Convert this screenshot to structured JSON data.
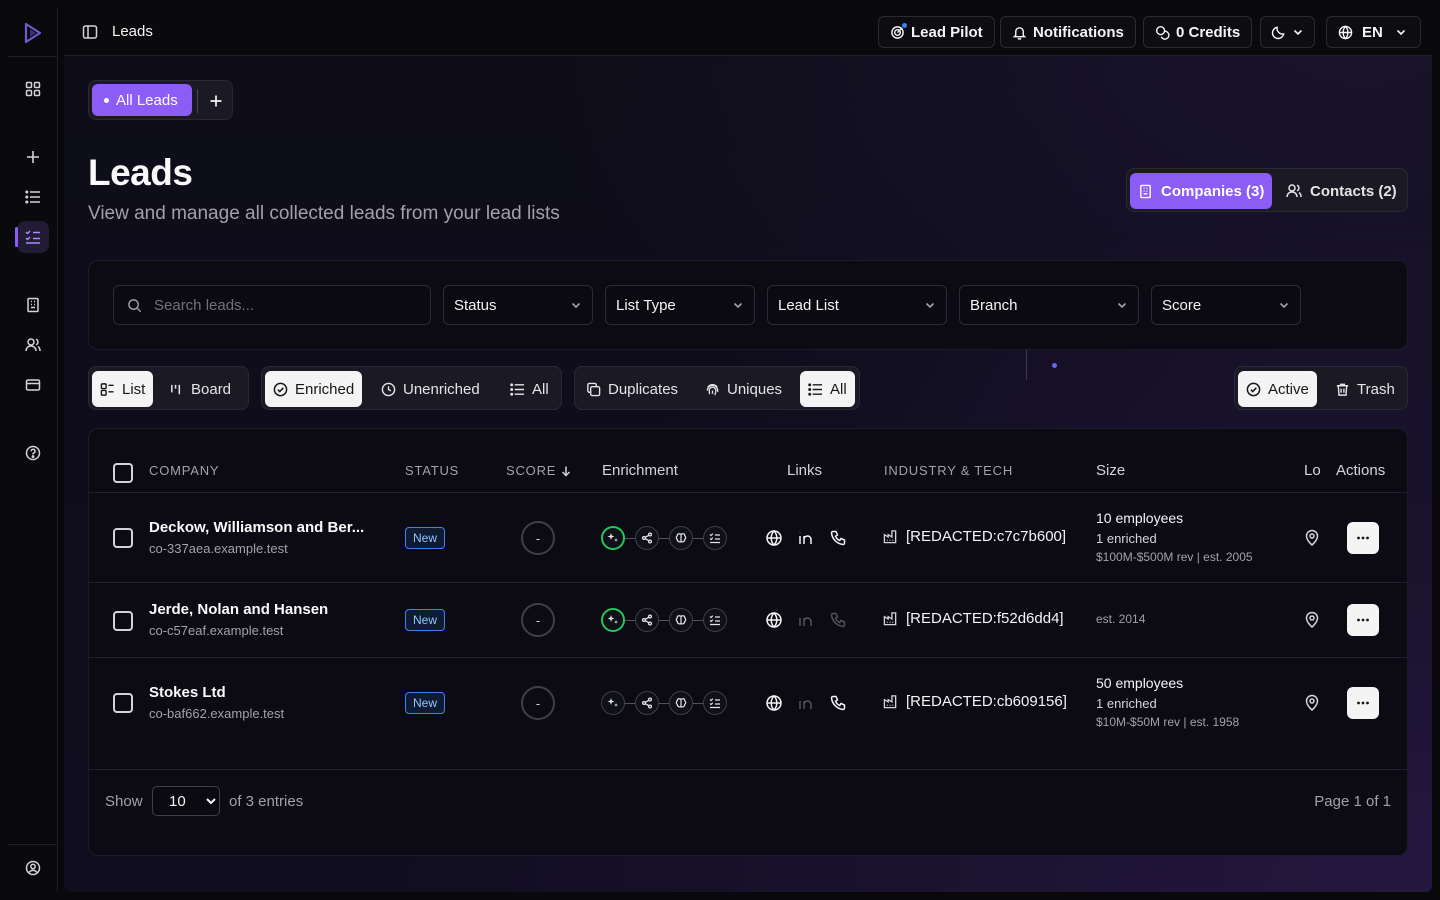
{
  "sidebar": {
    "items": [
      {
        "name": "dashboard",
        "icon": "grid-icon"
      },
      {
        "name": "new",
        "icon": "plus-icon"
      },
      {
        "name": "lists",
        "icon": "list-icon"
      },
      {
        "name": "leads",
        "icon": "list-check-icon",
        "active": true
      },
      {
        "name": "companies",
        "icon": "building-icon"
      },
      {
        "name": "contacts",
        "icon": "users-icon"
      },
      {
        "name": "billing",
        "icon": "credit-card-icon"
      },
      {
        "name": "help",
        "icon": "help-circle-icon"
      },
      {
        "name": "account",
        "icon": "user-circle-icon"
      }
    ]
  },
  "topbar": {
    "title": "Leads",
    "lead_pilot": "Lead Pilot",
    "notifications": "Notifications",
    "credits": "0 Credits",
    "language": "EN"
  },
  "tabs": {
    "all_leads": "All Leads"
  },
  "header": {
    "title": "Leads",
    "subtitle": "View and manage all collected leads from your lead lists",
    "companies": "Companies (3)",
    "contacts": "Contacts (2)"
  },
  "filters": {
    "search_placeholder": "Search leads...",
    "status": "Status",
    "list_type": "List Type",
    "lead_list": "Lead List",
    "branch": "Branch",
    "score": "Score"
  },
  "view_modes": {
    "list": "List",
    "board": "Board"
  },
  "enrichment_filter": {
    "enriched": "Enriched",
    "unenriched": "Unenriched",
    "all": "All"
  },
  "duplicate_filter": {
    "duplicates": "Duplicates",
    "uniques": "Uniques",
    "all": "All"
  },
  "state_filter": {
    "active": "Active",
    "trash": "Trash"
  },
  "table": {
    "columns": {
      "company": "COMPANY",
      "status": "STATUS",
      "score": "SCORE",
      "enrichment": "Enrichment",
      "links": "Links",
      "industry": "INDUSTRY & TECH",
      "size": "Size",
      "location": "Lo",
      "actions": "Actions"
    },
    "rows": [
      {
        "name": "Deckow, Williamson and Ber...",
        "domain": "co-337aea.example.test",
        "status": "New",
        "score": "-",
        "industry": "[REDACTED:c7c7b600]",
        "size_employees": "10 employees",
        "size_enriched": "1 enriched",
        "size_meta": "$100M-$500M rev  |  est. 2005"
      },
      {
        "name": "Jerde, Nolan and Hansen",
        "domain": "co-c57eaf.example.test",
        "status": "New",
        "score": "-",
        "industry": "[REDACTED:f52d6dd4]",
        "size_meta": "est. 2014"
      },
      {
        "name": "Stokes Ltd",
        "domain": "co-baf662.example.test",
        "status": "New",
        "score": "-",
        "industry": "[REDACTED:cb609156]",
        "size_employees": "50 employees",
        "size_enriched": "1 enriched",
        "size_meta": "$10M-$50M rev  |  est. 1958"
      }
    ]
  },
  "footer": {
    "show": "Show",
    "page_size": "10",
    "entries": "of 3 entries",
    "page": "Page 1 of 1"
  },
  "colors": {
    "accent": "#8b5cf6",
    "badge_blue": "#3b82f6",
    "enrich_ok": "#22c55e"
  }
}
